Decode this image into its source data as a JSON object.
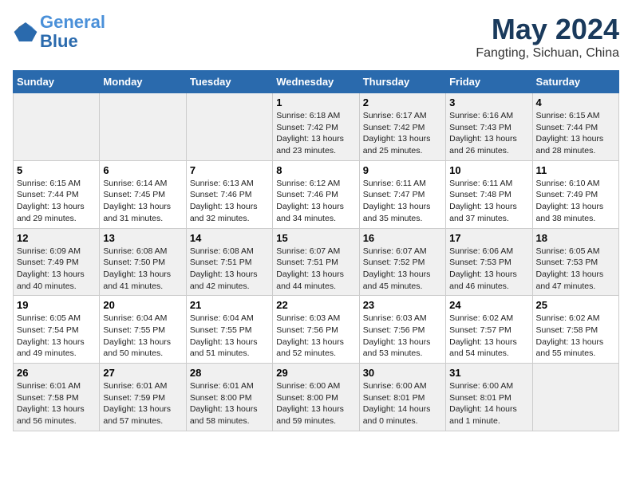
{
  "header": {
    "logo_line1": "General",
    "logo_line2": "Blue",
    "main_title": "May 2024",
    "subtitle": "Fangting, Sichuan, China"
  },
  "days_of_week": [
    "Sunday",
    "Monday",
    "Tuesday",
    "Wednesday",
    "Thursday",
    "Friday",
    "Saturday"
  ],
  "weeks": [
    [
      {
        "day": "",
        "info": ""
      },
      {
        "day": "",
        "info": ""
      },
      {
        "day": "",
        "info": ""
      },
      {
        "day": "1",
        "info": "Sunrise: 6:18 AM\nSunset: 7:42 PM\nDaylight: 13 hours\nand 23 minutes."
      },
      {
        "day": "2",
        "info": "Sunrise: 6:17 AM\nSunset: 7:42 PM\nDaylight: 13 hours\nand 25 minutes."
      },
      {
        "day": "3",
        "info": "Sunrise: 6:16 AM\nSunset: 7:43 PM\nDaylight: 13 hours\nand 26 minutes."
      },
      {
        "day": "4",
        "info": "Sunrise: 6:15 AM\nSunset: 7:44 PM\nDaylight: 13 hours\nand 28 minutes."
      }
    ],
    [
      {
        "day": "5",
        "info": "Sunrise: 6:15 AM\nSunset: 7:44 PM\nDaylight: 13 hours\nand 29 minutes."
      },
      {
        "day": "6",
        "info": "Sunrise: 6:14 AM\nSunset: 7:45 PM\nDaylight: 13 hours\nand 31 minutes."
      },
      {
        "day": "7",
        "info": "Sunrise: 6:13 AM\nSunset: 7:46 PM\nDaylight: 13 hours\nand 32 minutes."
      },
      {
        "day": "8",
        "info": "Sunrise: 6:12 AM\nSunset: 7:46 PM\nDaylight: 13 hours\nand 34 minutes."
      },
      {
        "day": "9",
        "info": "Sunrise: 6:11 AM\nSunset: 7:47 PM\nDaylight: 13 hours\nand 35 minutes."
      },
      {
        "day": "10",
        "info": "Sunrise: 6:11 AM\nSunset: 7:48 PM\nDaylight: 13 hours\nand 37 minutes."
      },
      {
        "day": "11",
        "info": "Sunrise: 6:10 AM\nSunset: 7:49 PM\nDaylight: 13 hours\nand 38 minutes."
      }
    ],
    [
      {
        "day": "12",
        "info": "Sunrise: 6:09 AM\nSunset: 7:49 PM\nDaylight: 13 hours\nand 40 minutes."
      },
      {
        "day": "13",
        "info": "Sunrise: 6:08 AM\nSunset: 7:50 PM\nDaylight: 13 hours\nand 41 minutes."
      },
      {
        "day": "14",
        "info": "Sunrise: 6:08 AM\nSunset: 7:51 PM\nDaylight: 13 hours\nand 42 minutes."
      },
      {
        "day": "15",
        "info": "Sunrise: 6:07 AM\nSunset: 7:51 PM\nDaylight: 13 hours\nand 44 minutes."
      },
      {
        "day": "16",
        "info": "Sunrise: 6:07 AM\nSunset: 7:52 PM\nDaylight: 13 hours\nand 45 minutes."
      },
      {
        "day": "17",
        "info": "Sunrise: 6:06 AM\nSunset: 7:53 PM\nDaylight: 13 hours\nand 46 minutes."
      },
      {
        "day": "18",
        "info": "Sunrise: 6:05 AM\nSunset: 7:53 PM\nDaylight: 13 hours\nand 47 minutes."
      }
    ],
    [
      {
        "day": "19",
        "info": "Sunrise: 6:05 AM\nSunset: 7:54 PM\nDaylight: 13 hours\nand 49 minutes."
      },
      {
        "day": "20",
        "info": "Sunrise: 6:04 AM\nSunset: 7:55 PM\nDaylight: 13 hours\nand 50 minutes."
      },
      {
        "day": "21",
        "info": "Sunrise: 6:04 AM\nSunset: 7:55 PM\nDaylight: 13 hours\nand 51 minutes."
      },
      {
        "day": "22",
        "info": "Sunrise: 6:03 AM\nSunset: 7:56 PM\nDaylight: 13 hours\nand 52 minutes."
      },
      {
        "day": "23",
        "info": "Sunrise: 6:03 AM\nSunset: 7:56 PM\nDaylight: 13 hours\nand 53 minutes."
      },
      {
        "day": "24",
        "info": "Sunrise: 6:02 AM\nSunset: 7:57 PM\nDaylight: 13 hours\nand 54 minutes."
      },
      {
        "day": "25",
        "info": "Sunrise: 6:02 AM\nSunset: 7:58 PM\nDaylight: 13 hours\nand 55 minutes."
      }
    ],
    [
      {
        "day": "26",
        "info": "Sunrise: 6:01 AM\nSunset: 7:58 PM\nDaylight: 13 hours\nand 56 minutes."
      },
      {
        "day": "27",
        "info": "Sunrise: 6:01 AM\nSunset: 7:59 PM\nDaylight: 13 hours\nand 57 minutes."
      },
      {
        "day": "28",
        "info": "Sunrise: 6:01 AM\nSunset: 8:00 PM\nDaylight: 13 hours\nand 58 minutes."
      },
      {
        "day": "29",
        "info": "Sunrise: 6:00 AM\nSunset: 8:00 PM\nDaylight: 13 hours\nand 59 minutes."
      },
      {
        "day": "30",
        "info": "Sunrise: 6:00 AM\nSunset: 8:01 PM\nDaylight: 14 hours\nand 0 minutes."
      },
      {
        "day": "31",
        "info": "Sunrise: 6:00 AM\nSunset: 8:01 PM\nDaylight: 14 hours\nand 1 minute."
      },
      {
        "day": "",
        "info": ""
      }
    ]
  ]
}
